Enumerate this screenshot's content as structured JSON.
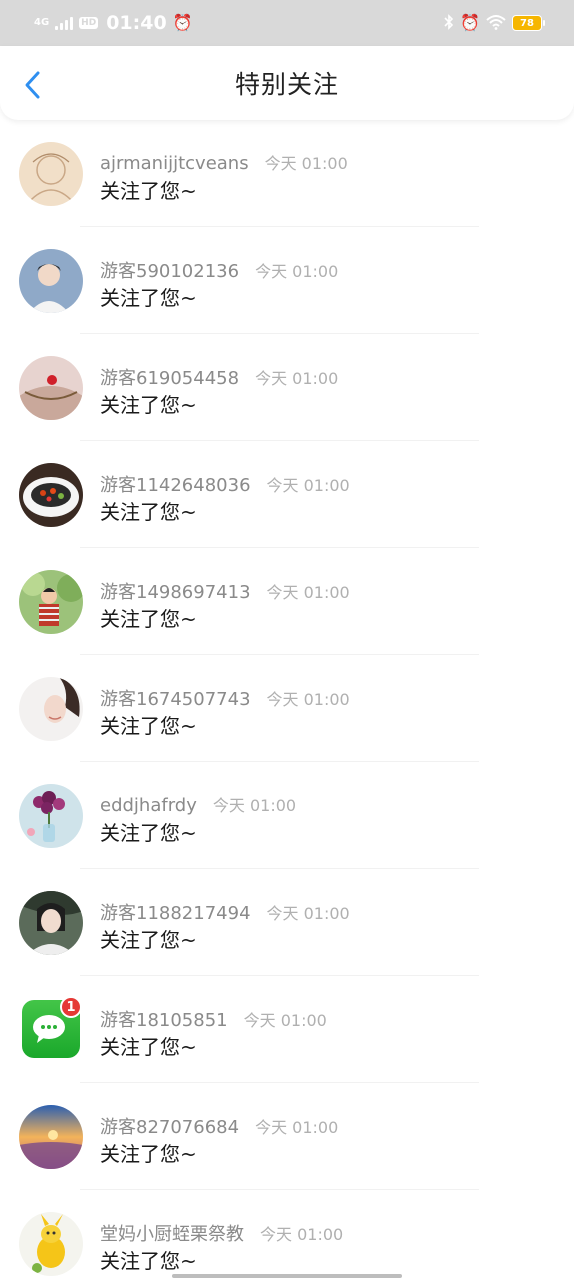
{
  "status_bar": {
    "network": "4G",
    "hd": "HD",
    "time": "01:40",
    "battery": "78"
  },
  "header": {
    "title": "特别关注",
    "back_icon": "chevron-left-icon"
  },
  "items": [
    {
      "name": "ajrmanijjtcveans",
      "time": "今天 01:00",
      "message": "关注了您~"
    },
    {
      "name": "游客590102136",
      "time": "今天 01:00",
      "message": "关注了您~"
    },
    {
      "name": "游客619054458",
      "time": "今天 01:00",
      "message": "关注了您~"
    },
    {
      "name": "游客1142648036",
      "time": "今天 01:00",
      "message": "关注了您~"
    },
    {
      "name": "游客1498697413",
      "time": "今天 01:00",
      "message": "关注了您~"
    },
    {
      "name": "游客1674507743",
      "time": "今天 01:00",
      "message": "关注了您~"
    },
    {
      "name": "eddjhafrdy",
      "time": "今天 01:00",
      "message": "关注了您~"
    },
    {
      "name": "游客1188217494",
      "time": "今天 01:00",
      "message": "关注了您~"
    },
    {
      "name": "游客18105851",
      "time": "今天 01:00",
      "message": "关注了您~",
      "badge": "1"
    },
    {
      "name": "游客827076684",
      "time": "今天 01:00",
      "message": "关注了您~"
    },
    {
      "name": "堂妈小厨蛭栗祭教",
      "time": "今天 01:00",
      "message": "关注了您~"
    }
  ],
  "colors": {
    "accent": "#2f8ff0",
    "status_bar_bg": "#d9d9d9",
    "battery": "#f6b600",
    "badge": "#e53935"
  }
}
